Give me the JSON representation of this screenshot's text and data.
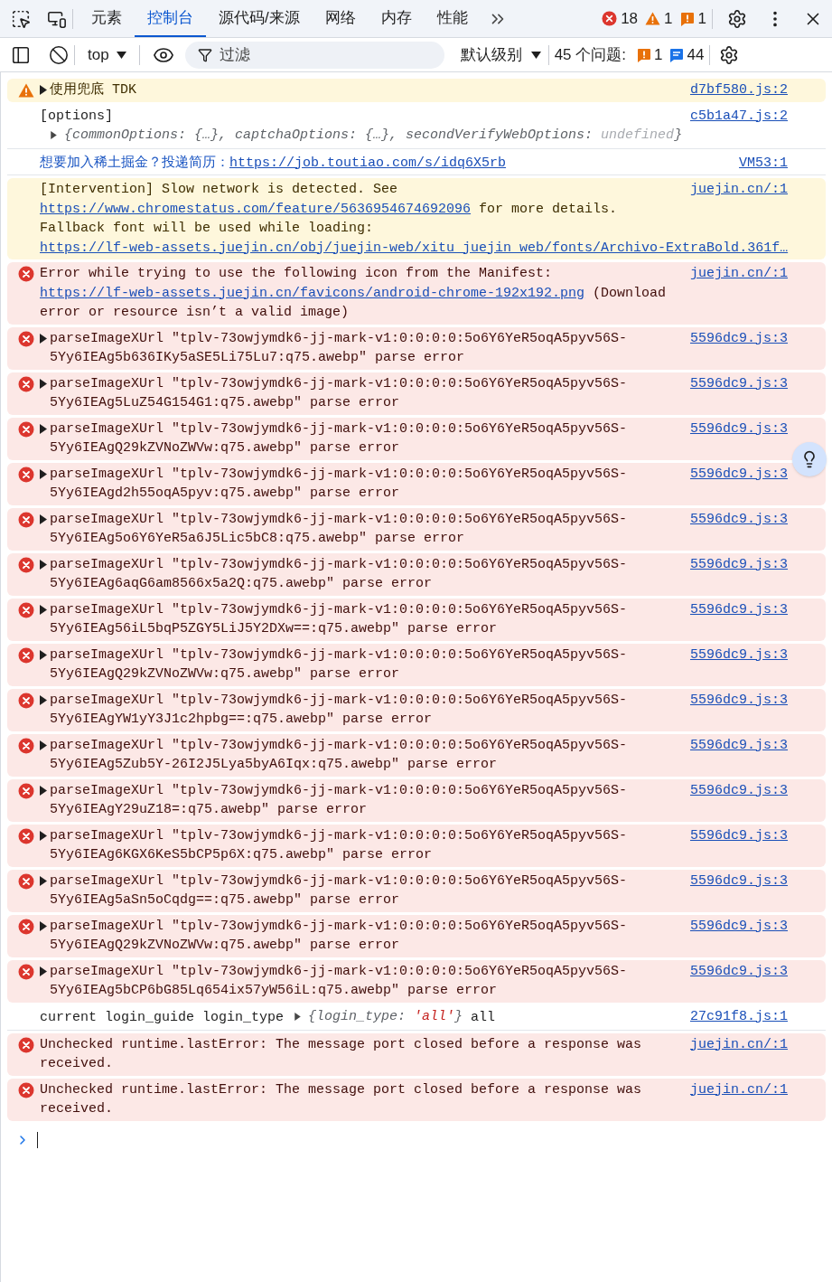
{
  "toolbar": {
    "tabs": [
      {
        "label": "元素",
        "selected": false
      },
      {
        "label": "控制台",
        "selected": true
      },
      {
        "label": "源代码/来源",
        "selected": false
      },
      {
        "label": "网络",
        "selected": false
      },
      {
        "label": "内存",
        "selected": false
      },
      {
        "label": "性能",
        "selected": false
      }
    ],
    "counts": {
      "errors": "18",
      "warnings": "1",
      "issues": "1"
    }
  },
  "console_toolbar": {
    "context": "top",
    "filter": {
      "placeholder": "过滤"
    },
    "level": "默认级别",
    "issues_label": "45 个问题:",
    "issue_counts": {
      "warnings": "1",
      "info": "44"
    }
  },
  "messages": [
    {
      "kind": "warning",
      "expandable": true,
      "segments": [
        {
          "kind": "text",
          "text": "使用兜底 TDK"
        }
      ],
      "source": "d7bf580.js:2"
    },
    {
      "kind": "log",
      "expandable": false,
      "segments": [
        {
          "kind": "text",
          "text": "[options]"
        },
        {
          "kind": "newline"
        },
        {
          "kind": "object",
          "parts": [
            {
              "kind": "plain",
              "text": "{commonOptions: {…}, captchaOptions: {…}, secondVerifyWebOptions: "
            },
            {
              "kind": "undefined",
              "text": "undefined"
            },
            {
              "kind": "plain",
              "text": "}"
            }
          ]
        }
      ],
      "source": "c5b1a47.js:2"
    },
    {
      "kind": "info",
      "expandable": false,
      "segments": [
        {
          "kind": "text",
          "text": "想要加入稀土掘金？投递简历："
        },
        {
          "kind": "link",
          "text": "https://job.toutiao.com/s/idq6X5rb"
        }
      ],
      "source": "VM53:1"
    },
    {
      "kind": "intervention",
      "expandable": false,
      "segments": [
        {
          "kind": "text",
          "text": "[Intervention] Slow network is detected. See "
        },
        {
          "kind": "link",
          "text": "https://www.chromestatus.com/feature/5636954674692096"
        },
        {
          "kind": "text",
          "text": " for more details. Fallback font will be used while loading:"
        },
        {
          "kind": "newline"
        },
        {
          "kind": "link",
          "text": "https://lf-web-assets.juejin.cn/obj/juejin-web/xitu_juejin_web/fonts/Archivo-ExtraBold.361f…"
        }
      ],
      "source": "juejin.cn/:1"
    },
    {
      "kind": "error",
      "expandable": false,
      "segments": [
        {
          "kind": "text",
          "text": "Error while trying to use the following icon from the Manifest: "
        },
        {
          "kind": "link",
          "text": "https://lf-web-assets.juejin.cn/favicons/android-chrome-192x192.png"
        },
        {
          "kind": "text",
          "text": " (Download error or resource isn’t a valid image)"
        }
      ],
      "source": "juejin.cn/:1"
    },
    {
      "kind": "error",
      "expandable": true,
      "segments": [
        {
          "kind": "text",
          "text": "parseImageXUrl \"tplv-73owjymdk6-jj-mark-v1:0:0:0:0:5o6Y6YeR5oqA5pyv56S-5Yy6IEAg5b636IKy5aSE5Li75Lu7:q75.awebp\" parse error"
        }
      ],
      "source": "5596dc9.js:3"
    },
    {
      "kind": "error",
      "expandable": true,
      "segments": [
        {
          "kind": "text",
          "text": "parseImageXUrl \"tplv-73owjymdk6-jj-mark-v1:0:0:0:0:5o6Y6YeR5oqA5pyv56S-5Yy6IEAg5LuZ54G154G1:q75.awebp\" parse error"
        }
      ],
      "source": "5596dc9.js:3"
    },
    {
      "kind": "error",
      "expandable": true,
      "segments": [
        {
          "kind": "text",
          "text": "parseImageXUrl \"tplv-73owjymdk6-jj-mark-v1:0:0:0:0:5o6Y6YeR5oqA5pyv56S-5Yy6IEAgQ29kZVNoZWVw:q75.awebp\" parse error"
        }
      ],
      "source": "5596dc9.js:3"
    },
    {
      "kind": "error",
      "expandable": true,
      "segments": [
        {
          "kind": "text",
          "text": "parseImageXUrl \"tplv-73owjymdk6-jj-mark-v1:0:0:0:0:5o6Y6YeR5oqA5pyv56S-5Yy6IEAgd2h55oqA5pyv:q75.awebp\" parse error"
        }
      ],
      "source": "5596dc9.js:3"
    },
    {
      "kind": "error",
      "expandable": true,
      "segments": [
        {
          "kind": "text",
          "text": "parseImageXUrl \"tplv-73owjymdk6-jj-mark-v1:0:0:0:0:5o6Y6YeR5oqA5pyv56S-5Yy6IEAg5o6Y6YeR5a6J5Lic5bC8:q75.awebp\" parse error"
        }
      ],
      "source": "5596dc9.js:3"
    },
    {
      "kind": "error",
      "expandable": true,
      "segments": [
        {
          "kind": "text",
          "text": "parseImageXUrl \"tplv-73owjymdk6-jj-mark-v1:0:0:0:0:5o6Y6YeR5oqA5pyv56S-5Yy6IEAg6aqG6am8566x5a2Q:q75.awebp\" parse error"
        }
      ],
      "source": "5596dc9.js:3"
    },
    {
      "kind": "error",
      "expandable": true,
      "segments": [
        {
          "kind": "text",
          "text": "parseImageXUrl \"tplv-73owjymdk6-jj-mark-v1:0:0:0:0:5o6Y6YeR5oqA5pyv56S-5Yy6IEAg56iL5bqP5ZGY5LiJ5Y2DXw==:q75.awebp\" parse error"
        }
      ],
      "source": "5596dc9.js:3"
    },
    {
      "kind": "error",
      "expandable": true,
      "segments": [
        {
          "kind": "text",
          "text": "parseImageXUrl \"tplv-73owjymdk6-jj-mark-v1:0:0:0:0:5o6Y6YeR5oqA5pyv56S-5Yy6IEAgQ29kZVNoZWVw:q75.awebp\" parse error"
        }
      ],
      "source": "5596dc9.js:3"
    },
    {
      "kind": "error",
      "expandable": true,
      "segments": [
        {
          "kind": "text",
          "text": "parseImageXUrl \"tplv-73owjymdk6-jj-mark-v1:0:0:0:0:5o6Y6YeR5oqA5pyv56S-5Yy6IEAgYW1yY3J1c2hpbg==:q75.awebp\" parse error"
        }
      ],
      "source": "5596dc9.js:3"
    },
    {
      "kind": "error",
      "expandable": true,
      "segments": [
        {
          "kind": "text",
          "text": "parseImageXUrl \"tplv-73owjymdk6-jj-mark-v1:0:0:0:0:5o6Y6YeR5oqA5pyv56S-5Yy6IEAg5Zub5Y-26I2J5Lya5byA6Iqx:q75.awebp\" parse error"
        }
      ],
      "source": "5596dc9.js:3"
    },
    {
      "kind": "error",
      "expandable": true,
      "segments": [
        {
          "kind": "text",
          "text": "parseImageXUrl \"tplv-73owjymdk6-jj-mark-v1:0:0:0:0:5o6Y6YeR5oqA5pyv56S-5Yy6IEAgY29uZ18=:q75.awebp\" parse error"
        }
      ],
      "source": "5596dc9.js:3"
    },
    {
      "kind": "error",
      "expandable": true,
      "segments": [
        {
          "kind": "text",
          "text": "parseImageXUrl \"tplv-73owjymdk6-jj-mark-v1:0:0:0:0:5o6Y6YeR5oqA5pyv56S-5Yy6IEAg6KGX6KeS5bCP5p6X:q75.awebp\" parse error"
        }
      ],
      "source": "5596dc9.js:3"
    },
    {
      "kind": "error",
      "expandable": true,
      "segments": [
        {
          "kind": "text",
          "text": "parseImageXUrl \"tplv-73owjymdk6-jj-mark-v1:0:0:0:0:5o6Y6YeR5oqA5pyv56S-5Yy6IEAg5aSn5oCqdg==:q75.awebp\" parse error"
        }
      ],
      "source": "5596dc9.js:3"
    },
    {
      "kind": "error",
      "expandable": true,
      "segments": [
        {
          "kind": "text",
          "text": "parseImageXUrl \"tplv-73owjymdk6-jj-mark-v1:0:0:0:0:5o6Y6YeR5oqA5pyv56S-5Yy6IEAgQ29kZVNoZWVw:q75.awebp\" parse error"
        }
      ],
      "source": "5596dc9.js:3"
    },
    {
      "kind": "error",
      "expandable": true,
      "segments": [
        {
          "kind": "text",
          "text": "parseImageXUrl \"tplv-73owjymdk6-jj-mark-v1:0:0:0:0:5o6Y6YeR5oqA5pyv56S-5Yy6IEAg5bCP6bG85Lq654ix57yW56iL:q75.awebp\" parse error"
        }
      ],
      "source": "5596dc9.js:3"
    },
    {
      "kind": "log",
      "expandable": false,
      "segments": [
        {
          "kind": "text",
          "text": "current login_guide login_type"
        },
        {
          "kind": "object",
          "parts": [
            {
              "kind": "plain",
              "text": "{login_type: "
            },
            {
              "kind": "string",
              "text": "'all'"
            },
            {
              "kind": "plain",
              "text": "}"
            }
          ]
        },
        {
          "kind": "text",
          "text": " all"
        }
      ],
      "source": "27c91f8.js:1"
    },
    {
      "kind": "error",
      "expandable": false,
      "segments": [
        {
          "kind": "text",
          "text": "Unchecked runtime.lastError: The message port closed before a response was received."
        }
      ],
      "source": "juejin.cn/:1"
    },
    {
      "kind": "error",
      "expandable": false,
      "segments": [
        {
          "kind": "text",
          "text": "Unchecked runtime.lastError: The message port closed before a response was received."
        }
      ],
      "source": "juejin.cn/:1"
    }
  ]
}
